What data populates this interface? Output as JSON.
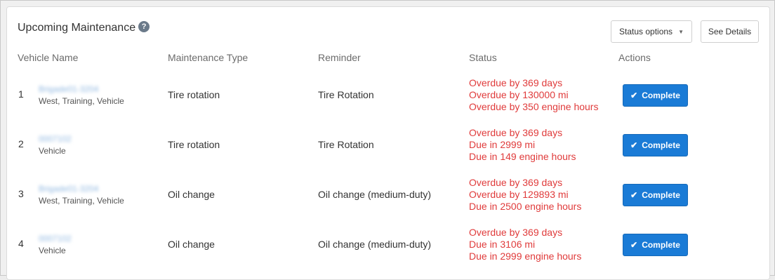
{
  "header": {
    "title": "Upcoming Maintenance",
    "help_icon": "?",
    "status_options_label": "Status options",
    "see_details_label": "See Details"
  },
  "columns": [
    "Vehicle Name",
    "Maintenance Type",
    "Reminder",
    "Status",
    "Actions"
  ],
  "rows": [
    {
      "num": "1",
      "vehicle_name": "Brigade01-3204",
      "vehicle_groups": "West, Training, Vehicle",
      "maintenance_type": "Tire rotation",
      "reminder": "Tire Rotation",
      "status": [
        "Overdue by 369 days",
        "Overdue by 130000 mi",
        "Overdue by 350 engine hours"
      ],
      "action_label": "Complete"
    },
    {
      "num": "2",
      "vehicle_name": "0007102",
      "vehicle_groups": "Vehicle",
      "maintenance_type": "Tire rotation",
      "reminder": "Tire Rotation",
      "status": [
        "Overdue by 369 days",
        "Due in 2999 mi",
        "Due in 149 engine hours"
      ],
      "action_label": "Complete"
    },
    {
      "num": "3",
      "vehicle_name": "Brigade01-3204",
      "vehicle_groups": "West, Training, Vehicle",
      "maintenance_type": "Oil change",
      "reminder": "Oil change (medium-duty)",
      "status": [
        "Overdue by 369 days",
        "Overdue by 129893 mi",
        "Due in 2500 engine hours"
      ],
      "action_label": "Complete"
    },
    {
      "num": "4",
      "vehicle_name": "0007102",
      "vehicle_groups": "Vehicle",
      "maintenance_type": "Oil change",
      "reminder": "Oil change (medium-duty)",
      "status": [
        "Overdue by 369 days",
        "Due in 3106 mi",
        "Due in 2999 engine hours"
      ],
      "action_label": "Complete"
    }
  ],
  "colors": {
    "accent": "#1a7bd6",
    "status_alert": "#e03b3b",
    "header_text": "#6b6b6b"
  },
  "icons": {
    "help": "question-circle-icon",
    "caret": "caret-down-icon",
    "check": "check-icon"
  }
}
